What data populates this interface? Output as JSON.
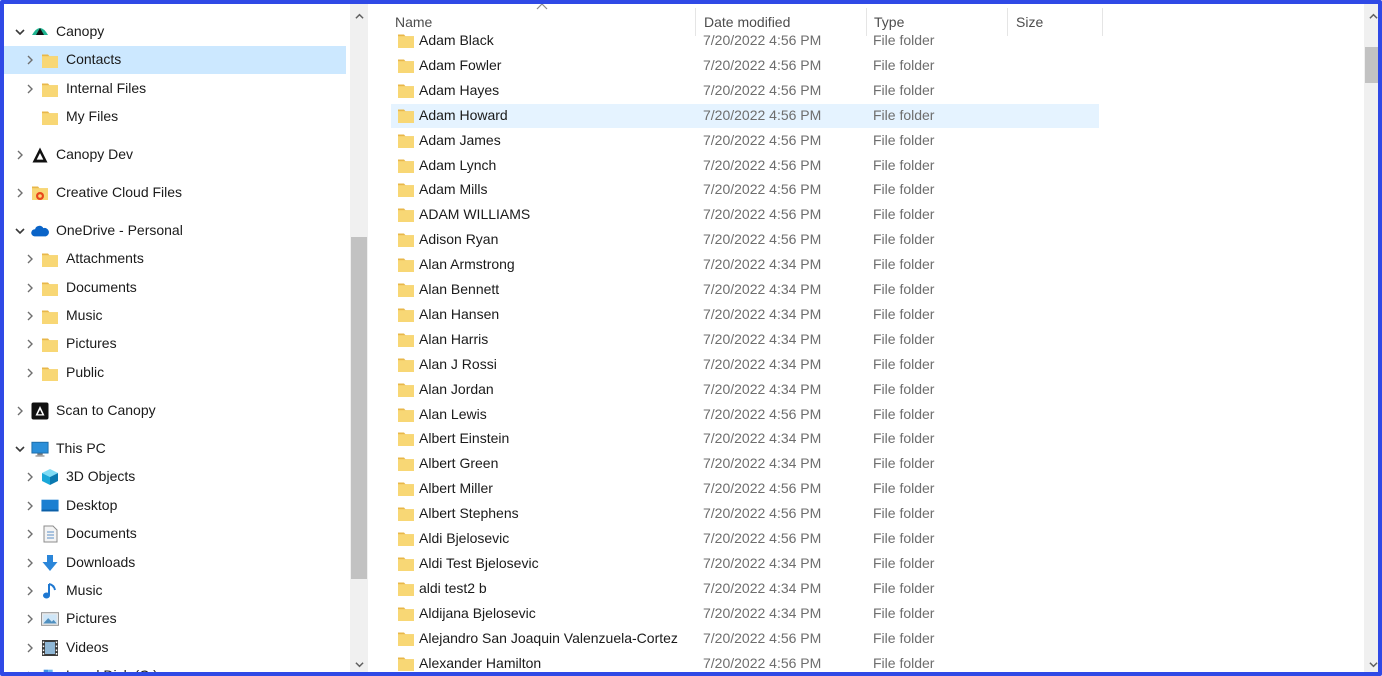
{
  "nav": {
    "items": [
      {
        "label": "Canopy",
        "expanded": true,
        "icon": "canopy-logo-icon",
        "level": 0
      },
      {
        "label": "Contacts",
        "expanded": false,
        "icon": "folder-icon",
        "level": 1,
        "selected": true
      },
      {
        "label": "Internal Files",
        "expanded": false,
        "icon": "folder-icon",
        "level": 1
      },
      {
        "label": "My Files",
        "expanded": null,
        "icon": "folder-icon",
        "level": 1
      },
      {
        "label": "Canopy Dev",
        "expanded": false,
        "icon": "canopy-dev-icon",
        "level": 0
      },
      {
        "label": "Creative Cloud Files",
        "expanded": false,
        "icon": "creative-cloud-icon",
        "level": 0
      },
      {
        "label": "OneDrive - Personal",
        "expanded": true,
        "icon": "onedrive-cloud-icon",
        "level": 0
      },
      {
        "label": "Attachments",
        "expanded": false,
        "icon": "folder-icon",
        "level": 1
      },
      {
        "label": "Documents",
        "expanded": false,
        "icon": "folder-icon",
        "level": 1
      },
      {
        "label": "Music",
        "expanded": false,
        "icon": "folder-icon",
        "level": 1
      },
      {
        "label": "Pictures",
        "expanded": false,
        "icon": "folder-icon",
        "level": 1
      },
      {
        "label": "Public",
        "expanded": false,
        "icon": "folder-icon",
        "level": 1
      },
      {
        "label": "Scan to Canopy",
        "expanded": false,
        "icon": "scan-to-canopy-icon",
        "level": 0
      },
      {
        "label": "This PC",
        "expanded": true,
        "icon": "computer-icon",
        "level": 0
      },
      {
        "label": "3D Objects",
        "expanded": false,
        "icon": "3d-objects-icon",
        "level": 1
      },
      {
        "label": "Desktop",
        "expanded": false,
        "icon": "desktop-icon",
        "level": 1
      },
      {
        "label": "Documents",
        "expanded": false,
        "icon": "documents-icon",
        "level": 1
      },
      {
        "label": "Downloads",
        "expanded": false,
        "icon": "download-arrow-icon",
        "level": 1
      },
      {
        "label": "Music",
        "expanded": false,
        "icon": "music-note-icon",
        "level": 1
      },
      {
        "label": "Pictures",
        "expanded": false,
        "icon": "pictures-icon",
        "level": 1
      },
      {
        "label": "Videos",
        "expanded": false,
        "icon": "videos-icon",
        "level": 1
      },
      {
        "label": "Local Disk (C:)",
        "expanded": false,
        "icon": "local-disk-icon",
        "level": 1
      }
    ]
  },
  "columns": {
    "name": "Name",
    "date_modified": "Date modified",
    "type": "Type",
    "size": "Size"
  },
  "files": [
    {
      "name": "Adam Black",
      "date": "7/20/2022 4:56 PM",
      "type": "File folder"
    },
    {
      "name": "Adam Fowler",
      "date": "7/20/2022 4:56 PM",
      "type": "File folder"
    },
    {
      "name": "Adam Hayes",
      "date": "7/20/2022 4:56 PM",
      "type": "File folder"
    },
    {
      "name": "Adam Howard",
      "date": "7/20/2022 4:56 PM",
      "type": "File folder",
      "hover": true
    },
    {
      "name": "Adam James",
      "date": "7/20/2022 4:56 PM",
      "type": "File folder"
    },
    {
      "name": "Adam Lynch",
      "date": "7/20/2022 4:56 PM",
      "type": "File folder"
    },
    {
      "name": "Adam Mills",
      "date": "7/20/2022 4:56 PM",
      "type": "File folder"
    },
    {
      "name": "ADAM WILLIAMS",
      "date": "7/20/2022 4:56 PM",
      "type": "File folder"
    },
    {
      "name": "Adison Ryan",
      "date": "7/20/2022 4:56 PM",
      "type": "File folder"
    },
    {
      "name": "Alan Armstrong",
      "date": "7/20/2022 4:34 PM",
      "type": "File folder"
    },
    {
      "name": "Alan Bennett",
      "date": "7/20/2022 4:34 PM",
      "type": "File folder"
    },
    {
      "name": "Alan Hansen",
      "date": "7/20/2022 4:34 PM",
      "type": "File folder"
    },
    {
      "name": "Alan Harris",
      "date": "7/20/2022 4:34 PM",
      "type": "File folder"
    },
    {
      "name": "Alan J Rossi",
      "date": "7/20/2022 4:34 PM",
      "type": "File folder"
    },
    {
      "name": "Alan Jordan",
      "date": "7/20/2022 4:34 PM",
      "type": "File folder"
    },
    {
      "name": "Alan Lewis",
      "date": "7/20/2022 4:56 PM",
      "type": "File folder"
    },
    {
      "name": "Albert Einstein",
      "date": "7/20/2022 4:34 PM",
      "type": "File folder"
    },
    {
      "name": "Albert Green",
      "date": "7/20/2022 4:34 PM",
      "type": "File folder"
    },
    {
      "name": "Albert Miller",
      "date": "7/20/2022 4:56 PM",
      "type": "File folder"
    },
    {
      "name": "Albert Stephens",
      "date": "7/20/2022 4:56 PM",
      "type": "File folder"
    },
    {
      "name": "Aldi Bjelosevic",
      "date": "7/20/2022 4:56 PM",
      "type": "File folder"
    },
    {
      "name": "Aldi Test Bjelosevic",
      "date": "7/20/2022 4:34 PM",
      "type": "File folder"
    },
    {
      "name": "aldi test2 b",
      "date": "7/20/2022 4:34 PM",
      "type": "File folder"
    },
    {
      "name": "Aldijana Bjelosevic",
      "date": "7/20/2022 4:34 PM",
      "type": "File folder"
    },
    {
      "name": "Alejandro San Joaquin Valenzuela-Cortez",
      "date": "7/20/2022 4:56 PM",
      "type": "File folder"
    },
    {
      "name": "Alexander Hamilton",
      "date": "7/20/2022 4:56 PM",
      "type": "File folder"
    }
  ],
  "colors": {
    "frame_border": "#2f49e6",
    "selected_bg": "#cce8ff",
    "hover_bg": "#e5f3ff",
    "folder_yellow": "#f8d775"
  }
}
